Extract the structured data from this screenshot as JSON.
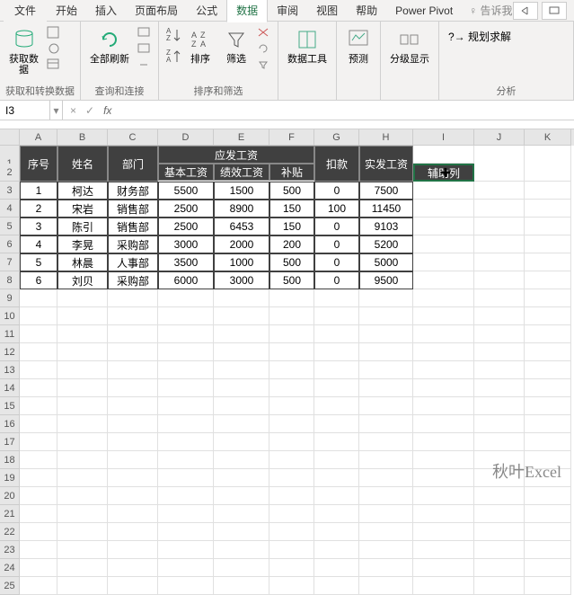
{
  "tabs": {
    "file": "文件",
    "items": [
      "开始",
      "插入",
      "页面布局",
      "公式",
      "数据",
      "审阅",
      "视图",
      "帮助",
      "Power Pivot"
    ],
    "active": "数据",
    "tell": "告诉我"
  },
  "ribbon": {
    "g1": {
      "btn": "获取数\n据",
      "label": "获取和转换数据"
    },
    "g2": {
      "btn": "全部刷新",
      "label": "查询和连接"
    },
    "g3": {
      "sort": "排序",
      "filter": "筛选",
      "label": "排序和筛选"
    },
    "g4": {
      "btn": "数据工具"
    },
    "g5": {
      "btn": "预测"
    },
    "g6": {
      "btn": "分级显示"
    },
    "g7": {
      "btn": "规划求解",
      "label": "分析"
    }
  },
  "namebox": "I3",
  "formula": "",
  "cols": [
    "A",
    "B",
    "C",
    "D",
    "E",
    "F",
    "G",
    "H",
    "I",
    "J",
    "K"
  ],
  "table": {
    "header1": {
      "A": "序号",
      "B": "姓名",
      "C": "部门",
      "DEF": "应发工资",
      "G": "扣款",
      "H": "实发工资"
    },
    "header2": {
      "D": "基本工资",
      "E": "绩效工资",
      "F": "补贴",
      "I": "辅助列"
    },
    "rows": [
      {
        "n": "1",
        "name": "柯达",
        "dept": "财务部",
        "base": "5500",
        "perf": "1500",
        "sub": "500",
        "ded": "0",
        "net": "7500"
      },
      {
        "n": "2",
        "name": "宋岩",
        "dept": "销售部",
        "base": "2500",
        "perf": "8900",
        "sub": "150",
        "ded": "100",
        "net": "11450"
      },
      {
        "n": "3",
        "name": "陈引",
        "dept": "销售部",
        "base": "2500",
        "perf": "6453",
        "sub": "150",
        "ded": "0",
        "net": "9103"
      },
      {
        "n": "4",
        "name": "李晃",
        "dept": "采购部",
        "base": "3000",
        "perf": "2000",
        "sub": "200",
        "ded": "0",
        "net": "5200"
      },
      {
        "n": "5",
        "name": "林晨",
        "dept": "人事部",
        "base": "3500",
        "perf": "1000",
        "sub": "500",
        "ded": "0",
        "net": "5000"
      },
      {
        "n": "6",
        "name": "刘贝",
        "dept": "采购部",
        "base": "6000",
        "perf": "3000",
        "sub": "500",
        "ded": "0",
        "net": "9500"
      }
    ]
  },
  "watermark": "秋叶Excel"
}
